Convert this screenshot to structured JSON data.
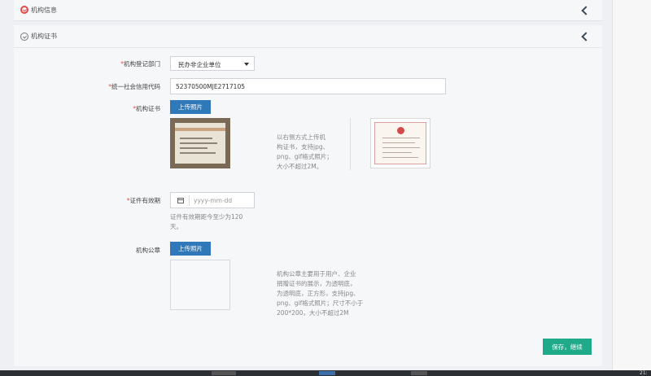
{
  "sections": {
    "collapsed_title": "机构信息",
    "open_title": "机构证书"
  },
  "form": {
    "registry_label": "机构登记部门",
    "registry_value": "民办非企业单位",
    "credit_code_label": "统一社会信用代码",
    "credit_code_value": "52370500MJE2717105",
    "certificate_label": "机构证书",
    "upload_label": "上传照片",
    "certificate_note_lines": [
      "以右侧方式上传机",
      "构证书，支持jpg、",
      "png、gif格式照片；",
      "大小不超过2M。"
    ],
    "validity_label": "证件有效期",
    "validity_placeholder": "yyyy-mm-dd",
    "validity_note_lines": [
      "证件有效期距今至少为120",
      "天。"
    ],
    "seal_label": "机构公章",
    "seal_upload_label": "上传照片",
    "seal_note_lines": [
      "机构公章主要用于用户、企业",
      "捐赠证书的展示，为透明底，",
      "为透明底，正方形，支持jpg、",
      "png、gif格式照片；尺寸不小于",
      "200*200，大小不超过2M"
    ],
    "save_label": "保存，继续"
  },
  "taskbar": {
    "clock_partial": "21:"
  },
  "icons": {
    "section_done": "check-circle-icon",
    "section_state": "chevron-left-icon",
    "date": "calendar-icon"
  },
  "colors": {
    "primary_button": "#2f79ba",
    "save_button": "#1fab89",
    "required_mark": "#e24a4a",
    "status_done": "#e24a4a"
  }
}
